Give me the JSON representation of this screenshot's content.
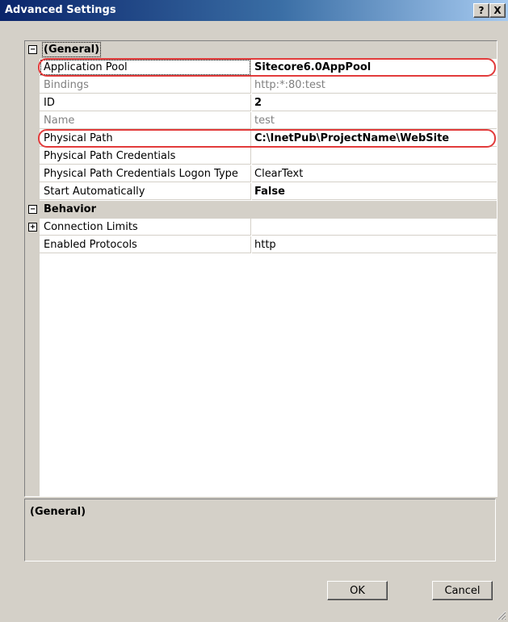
{
  "window": {
    "title": "Advanced Settings",
    "help_glyph": "?",
    "close_glyph": "X"
  },
  "grid": {
    "categories": [
      {
        "label": "(General)",
        "expander": "−"
      },
      {
        "label": "Behavior",
        "expander": "−"
      }
    ],
    "properties": [
      {
        "name": "Application Pool",
        "value": "Sitecore6.0AppPool"
      },
      {
        "name": "Bindings",
        "value": "http:*:80:test"
      },
      {
        "name": "ID",
        "value": "2"
      },
      {
        "name": "Name",
        "value": "test"
      },
      {
        "name": "Physical Path",
        "value": "C:\\InetPub\\ProjectName\\WebSite"
      },
      {
        "name": "Physical Path Credentials",
        "value": ""
      },
      {
        "name": "Physical Path Credentials Logon Type",
        "value": "ClearText"
      },
      {
        "name": "Start Automatically",
        "value": "False"
      },
      {
        "name": "Connection Limits",
        "value": "",
        "expander": "+"
      },
      {
        "name": "Enabled Protocols",
        "value": "http"
      }
    ]
  },
  "description": {
    "title": "(General)"
  },
  "buttons": {
    "ok_label": "OK",
    "cancel_label": "Cancel"
  },
  "colors": {
    "highlight_ring": "#e23b3b",
    "titlebar_start": "#0a246a",
    "titlebar_end": "#a6caf0",
    "dialog_bg": "#d4d0c8"
  }
}
